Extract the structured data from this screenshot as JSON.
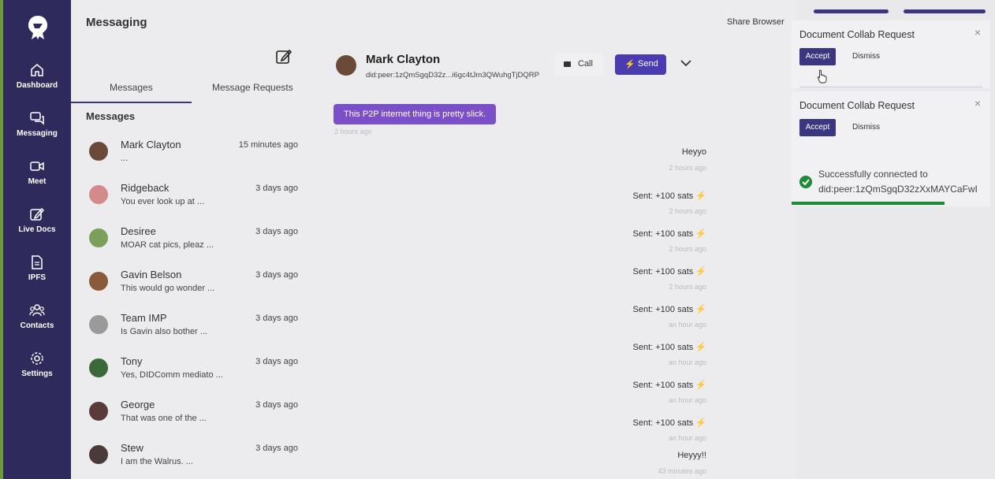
{
  "sidebar": {
    "items": [
      {
        "label": "Dashboard",
        "icon": "home-icon"
      },
      {
        "label": "Messaging",
        "icon": "chat-icon"
      },
      {
        "label": "Meet",
        "icon": "video-icon"
      },
      {
        "label": "Live Docs",
        "icon": "edit-icon"
      },
      {
        "label": "IPFS",
        "icon": "file-icon"
      },
      {
        "label": "Contacts",
        "icon": "contacts-icon"
      },
      {
        "label": "Settings",
        "icon": "gear-icon"
      }
    ]
  },
  "list": {
    "title": "Messaging",
    "tabs": [
      "Messages",
      "Message Requests"
    ],
    "section_heading": "Messages",
    "conversations": [
      {
        "name": "Mark Clayton",
        "time": "15 minutes ago",
        "preview": "...",
        "avatar_color": "#6b4a3a"
      },
      {
        "name": "Ridgeback",
        "time": "3 days ago",
        "preview": "You ever look up at ...",
        "avatar_color": "#d58a8a"
      },
      {
        "name": "Desiree",
        "time": "3 days ago",
        "preview": "MOAR cat pics, pleaz ...",
        "avatar_color": "#7aa05a"
      },
      {
        "name": "Gavin Belson",
        "time": "3 days ago",
        "preview": "This would go wonder ...",
        "avatar_color": "#8a5a3a"
      },
      {
        "name": "Team IMP",
        "time": "3 days ago",
        "preview": "Is Gavin also bother ...",
        "avatar_color": "#9a9a9a"
      },
      {
        "name": "Tony",
        "time": "3 days ago",
        "preview": "Yes, DIDComm mediato ...",
        "avatar_color": "#3a6a3a"
      },
      {
        "name": "George",
        "time": "3 days ago",
        "preview": "That was one of the ...",
        "avatar_color": "#5a3a3a"
      },
      {
        "name": "Stew",
        "time": "3 days ago",
        "preview": "I am the Walrus. ...",
        "avatar_color": "#4a3a3a"
      }
    ]
  },
  "chat": {
    "contact_name": "Mark Clayton",
    "contact_did": "did:peer:1zQmSgqD32z...i6gc4tJm3QWuhgTjDQRP",
    "call_label": "Call",
    "send_label": "Send",
    "incoming": {
      "text": "This P2P internet thing is pretty slick.",
      "time": "2 hours ago"
    },
    "outgoing": [
      {
        "text": "Heyyo",
        "time": "2 hours ago"
      },
      {
        "text": "Sent: +100 sats ⚡",
        "time": "2 hours ago"
      },
      {
        "text": "Sent: +100 sats ⚡",
        "time": "2 hours ago"
      },
      {
        "text": "Sent: +100 sats ⚡",
        "time": "2 hours ago"
      },
      {
        "text": "Sent: +100 sats ⚡",
        "time": "an hour ago"
      },
      {
        "text": "Sent: +100 sats ⚡",
        "time": "an hour ago"
      },
      {
        "text": "Sent: +100 sats ⚡",
        "time": "an hour ago"
      },
      {
        "text": "Sent: +100 sats ⚡",
        "time": "an hour ago"
      },
      {
        "text": "Heyyy!!",
        "time": "43 minutes ago"
      }
    ]
  },
  "right": {
    "share_label": "Share Browser",
    "notifications": [
      {
        "title": "Document Collab Request",
        "accept": "Accept",
        "dismiss": "Dismiss",
        "close": "×"
      },
      {
        "title": "Document Collab Request",
        "accept": "Accept",
        "dismiss": "Dismiss",
        "close": "×"
      }
    ],
    "toast": {
      "line1": "Successfully connected to",
      "line2": "did:peer:1zQmSgqD32zXxMAYCaFwI",
      "progress_fraction": 0.77
    }
  },
  "colors": {
    "sidebar": "#2f2a5c",
    "accent": "#4a3bb0",
    "bubble": "#7b4fc7",
    "success": "#1e8b3a"
  }
}
